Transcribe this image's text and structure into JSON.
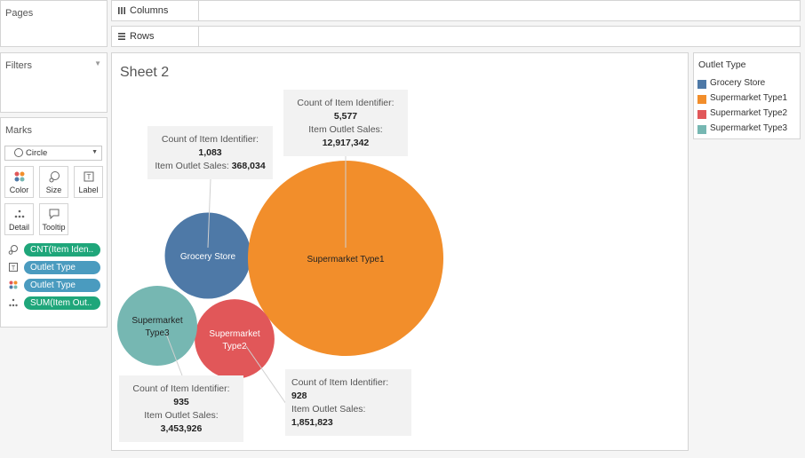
{
  "left": {
    "pages_title": "Pages",
    "filters_title": "Filters",
    "marks_title": "Marks",
    "mark_type": "Circle",
    "buttons": [
      {
        "icon": "color-icon",
        "label": "Color"
      },
      {
        "icon": "size-icon",
        "label": "Size"
      },
      {
        "icon": "label-icon",
        "label": "Label"
      },
      {
        "icon": "detail-icon",
        "label": "Detail"
      },
      {
        "icon": "tooltip-icon",
        "label": "Tooltip"
      }
    ],
    "pills": [
      {
        "icon": "size-icon",
        "label": "CNT(Item Iden.."
      },
      {
        "icon": "label-icon",
        "label": "Outlet Type"
      },
      {
        "icon": "color-icon",
        "label": "Outlet Type"
      },
      {
        "icon": "detail-icon",
        "label": "SUM(Item Out.."
      }
    ]
  },
  "shelves": {
    "columns": "Columns",
    "rows": "Rows"
  },
  "sheet": {
    "title": "Sheet 2"
  },
  "legend": {
    "title": "Outlet Type",
    "items": [
      {
        "label": "Grocery Store",
        "color": "#4e79a7"
      },
      {
        "label": "Supermarket Type1",
        "color": "#f28e2b"
      },
      {
        "label": "Supermarket Type2",
        "color": "#e15759"
      },
      {
        "label": "Supermarket Type3",
        "color": "#76b7b2"
      }
    ]
  },
  "chart_data": {
    "type": "packed-bubble",
    "size_measure": "Count of Item Identifier",
    "detail_measure": "Item Outlet Sales",
    "categories": [
      "Grocery Store",
      "Supermarket Type1",
      "Supermarket Type2",
      "Supermarket Type3"
    ],
    "count_values": [
      1083,
      5577,
      928,
      935
    ],
    "sales_values": [
      368034,
      12917342,
      1851823,
      3453926
    ],
    "tooltips": [
      {
        "count_label": "Count of Item Identifier:",
        "count": "1,083",
        "sales_label": "Item Outlet Sales:",
        "sales": "368,034"
      },
      {
        "count_label": "Count of Item Identifier:",
        "count": "5,577",
        "sales_label": "Item Outlet Sales:",
        "sales": "12,917,342"
      },
      {
        "count_label": "Count of Item Identifier:",
        "count": "928",
        "sales_label": "Item Outlet Sales:",
        "sales": "1,851,823"
      },
      {
        "count_label": "Count of Item Identifier:",
        "count": "935",
        "sales_label": "Item Outlet Sales:",
        "sales": "3,453,926"
      }
    ],
    "bubble_labels": [
      [
        "Grocery Store"
      ],
      [
        "Supermarket Type1"
      ],
      [
        "Supermarket",
        "Type2"
      ],
      [
        "Supermarket",
        "Type3"
      ]
    ],
    "colors": [
      "#4e79a7",
      "#f28e2b",
      "#e15759",
      "#76b7b2"
    ],
    "label_colors": [
      "#ffffff",
      "#222222",
      "#ffffff",
      "#222222"
    ]
  }
}
